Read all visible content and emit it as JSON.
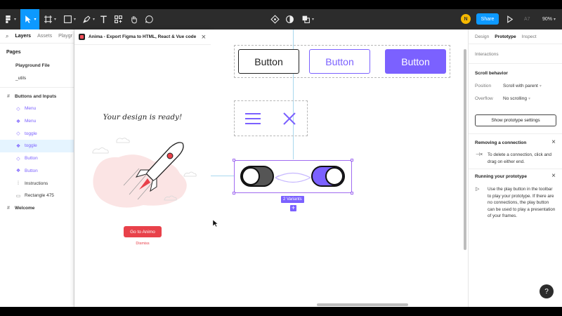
{
  "toolbar": {
    "share_label": "Share",
    "avatar_initial": "N",
    "font_label": "A7",
    "zoom": "90%"
  },
  "left_panel": {
    "tabs": [
      "Layers",
      "Assets",
      "Playgr"
    ],
    "pages_heading": "Pages",
    "pages": [
      "Playground File",
      "_utils"
    ],
    "layers": [
      {
        "label": "Buttons and Inputs"
      },
      {
        "label": "Menu"
      },
      {
        "label": "Menu"
      },
      {
        "label": "toggle"
      },
      {
        "label": "toggle"
      },
      {
        "label": "Button"
      },
      {
        "label": "Button"
      },
      {
        "label": "Instructions"
      },
      {
        "label": "Rectangle 475"
      },
      {
        "label": "Welcome"
      }
    ]
  },
  "plugin": {
    "title": "Anima - Export Figma to HTML, React & Vue code",
    "ready_text": "Your design is ready!",
    "cta_label": "Go to Animo",
    "dismiss_label": "Dismiss"
  },
  "canvas": {
    "buttons": [
      "Button",
      "Button",
      "Button"
    ],
    "variants_badge": "2 Variants",
    "plus": "+"
  },
  "right_panel": {
    "tabs": [
      "Design",
      "Prototype",
      "Inspect"
    ],
    "interactions_label": "Interactions",
    "scroll_heading": "Scroll behavior",
    "position_label": "Position",
    "position_value": "Scroll with parent",
    "overflow_label": "Overflow",
    "overflow_value": "No scrolling",
    "settings_button": "Show prototype settings",
    "removing_heading": "Removing a connection",
    "removing_body": "To delete a connection, click and drag on either end.",
    "running_heading": "Running your prototype",
    "running_body": "Use the play button in the toolbar to play your prototype. If there are no connections, the play button can be used to play a presentation of your frames.",
    "help": "?"
  },
  "colors": {
    "accent": "#0d99ff",
    "purple": "#7b61ff",
    "anima_red": "#e8414a",
    "toolbar_bg": "#2c2c2c"
  }
}
